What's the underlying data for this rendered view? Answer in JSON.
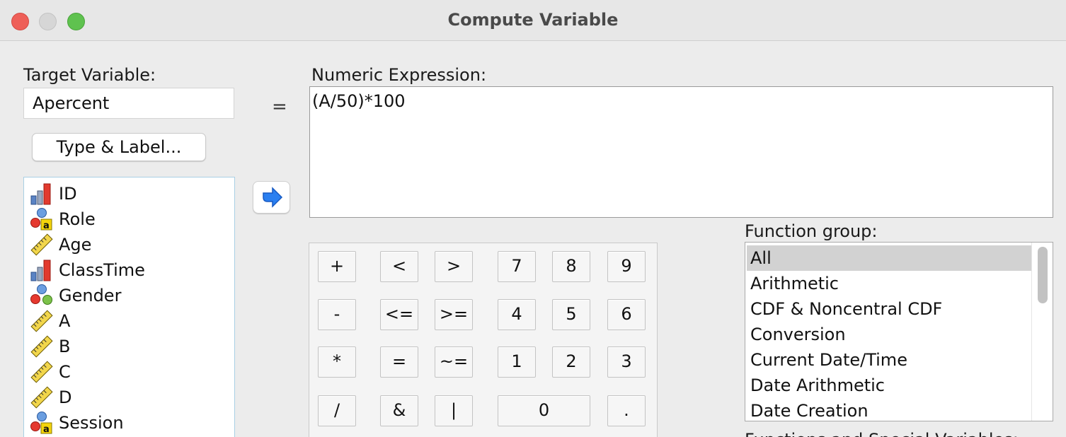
{
  "window": {
    "title": "Compute Variable"
  },
  "target": {
    "label": "Target Variable:",
    "value": "Apercent",
    "type_label_button": "Type & Label..."
  },
  "equals_sign": "=",
  "expression": {
    "label": "Numeric Expression:",
    "value": "(A/50)*100"
  },
  "variables": [
    {
      "name": "ID",
      "icon": "ordinal-bar-icon"
    },
    {
      "name": "Role",
      "icon": "nominal-string-icon"
    },
    {
      "name": "Age",
      "icon": "scale-ruler-icon"
    },
    {
      "name": "ClassTime",
      "icon": "ordinal-bar-icon"
    },
    {
      "name": "Gender",
      "icon": "nominal-icon"
    },
    {
      "name": "A",
      "icon": "scale-ruler-icon"
    },
    {
      "name": "B",
      "icon": "scale-ruler-icon"
    },
    {
      "name": "C",
      "icon": "scale-ruler-icon"
    },
    {
      "name": "D",
      "icon": "scale-ruler-icon"
    },
    {
      "name": "Session",
      "icon": "nominal-string-icon"
    }
  ],
  "keypad": [
    [
      "+",
      "<",
      ">",
      "7",
      "8",
      "9"
    ],
    [
      "-",
      "<=",
      ">=",
      "4",
      "5",
      "6"
    ],
    [
      "*",
      "=",
      "~=",
      "1",
      "2",
      "3"
    ],
    [
      "/",
      "&",
      "|",
      "0",
      "."
    ]
  ],
  "function_group": {
    "label": "Function group:",
    "items": [
      "All",
      "Arithmetic",
      "CDF & Noncentral CDF",
      "Conversion",
      "Current Date/Time",
      "Date Arithmetic",
      "Date Creation"
    ],
    "selected": "All"
  },
  "functions_label_cutoff": "Functions and Special Variables:",
  "colors": {
    "accent_arrow": "#2a7ff0",
    "selection": "#d2d2d2",
    "close": "#ee5f58",
    "maximize": "#5fc24f"
  }
}
